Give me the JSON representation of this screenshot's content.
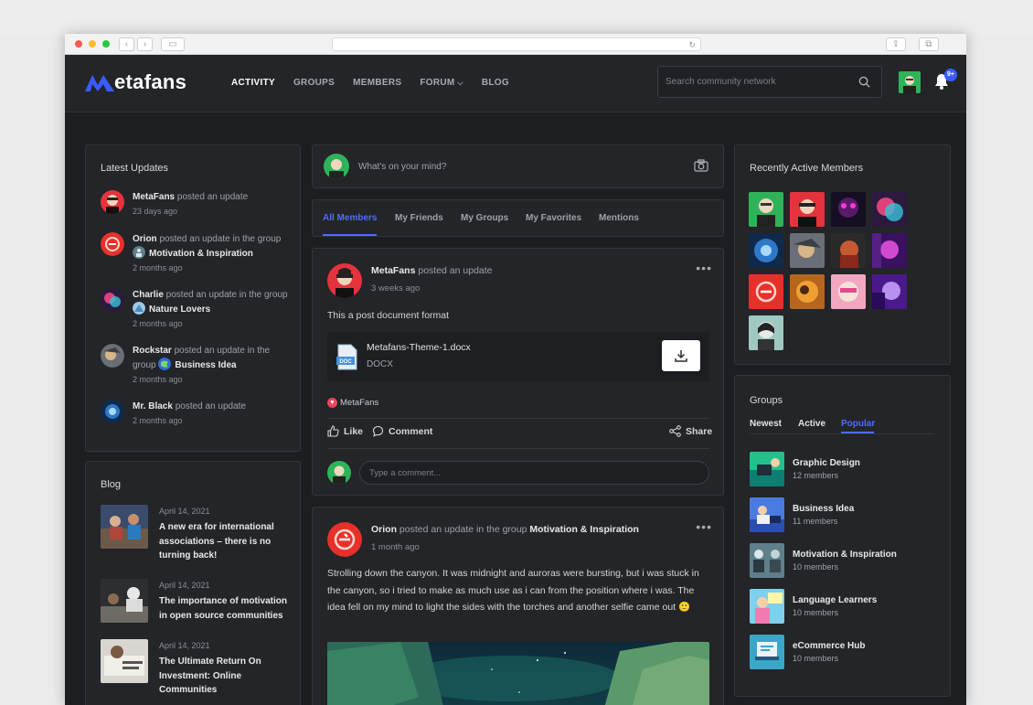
{
  "header": {
    "logo": "Metafans",
    "nav": [
      {
        "label": "ACTIVITY",
        "active": true
      },
      {
        "label": "GROUPS",
        "active": false
      },
      {
        "label": "MEMBERS",
        "active": false
      },
      {
        "label": "FORUM",
        "active": false
      },
      {
        "label": "BLOG",
        "active": false
      }
    ],
    "search_placeholder": "Search community network",
    "notification_count": "9+"
  },
  "latest_updates": {
    "title": "Latest Updates",
    "items": [
      {
        "user": "MetaFans",
        "action": " posted an update",
        "group": "",
        "time": "23 days ago"
      },
      {
        "user": "Orion",
        "action": " posted an update in the group",
        "group": "Motivation & Inspiration",
        "time": "2 months ago"
      },
      {
        "user": "Charlie",
        "action": " posted an update in the group",
        "group": "Nature Lovers",
        "time": "2 months ago"
      },
      {
        "user": "Rockstar",
        "action": " posted an update in the group",
        "group": "Business Idea",
        "time": "2 months ago"
      },
      {
        "user": "Mr. Black",
        "action": " posted an update",
        "group": "",
        "time": "2 months ago"
      }
    ]
  },
  "blog": {
    "title": "Blog",
    "items": [
      {
        "date": "April 14, 2021",
        "title": "A new era for international associations – there is no turning back!"
      },
      {
        "date": "April 14, 2021",
        "title": "The importance of motivation in open source communities"
      },
      {
        "date": "April 14, 2021",
        "title": "The Ultimate Return On Investment: Online Communities"
      }
    ]
  },
  "composer": {
    "placeholder": "What's on your mind?"
  },
  "feed_tabs": [
    {
      "label": "All Members",
      "active": true
    },
    {
      "label": "My Friends",
      "active": false
    },
    {
      "label": "My Groups",
      "active": false
    },
    {
      "label": "My Favorites",
      "active": false
    },
    {
      "label": "Mentions",
      "active": false
    }
  ],
  "post1": {
    "author": "MetaFans",
    "action": " posted an update",
    "time": "3 weeks ago",
    "text": "This a post document format",
    "doc_name": "Metafans-Theme-1.docx",
    "doc_type": "DOCX",
    "doc_badge": "DOC",
    "reactor": "MetaFans",
    "like_label": "Like",
    "comment_label": "Comment",
    "share_label": "Share",
    "comment_placeholder": "Type a comment..."
  },
  "post2": {
    "author": "Orion",
    "action": " posted an update in the group ",
    "group": "Motivation & Inspiration",
    "time": "1 month ago",
    "text": "Strolling down the canyon. It was midnight and auroras were bursting, but i was stuck in the canyon, so i tried to make as much use as i can from the position where i was. The idea fell on my mind to light the sides with the torches and another selfie came out 🙂"
  },
  "recent_members": {
    "title": "Recently Active Members"
  },
  "groups": {
    "title": "Groups",
    "tabs": [
      {
        "label": "Newest",
        "active": false
      },
      {
        "label": "Active",
        "active": false
      },
      {
        "label": "Popular",
        "active": true
      }
    ],
    "items": [
      {
        "name": "Graphic Design",
        "members": "12 members"
      },
      {
        "name": "Business Idea",
        "members": "11 members"
      },
      {
        "name": "Motivation & Inspiration",
        "members": "10 members"
      },
      {
        "name": "Language Learners",
        "members": "10 members"
      },
      {
        "name": "eCommerce Hub",
        "members": "10 members"
      }
    ]
  },
  "colors": {
    "accent": "#4f6cff",
    "logo_blue": "#3a5cff",
    "background": "#1c1e21",
    "card": "#232528"
  }
}
